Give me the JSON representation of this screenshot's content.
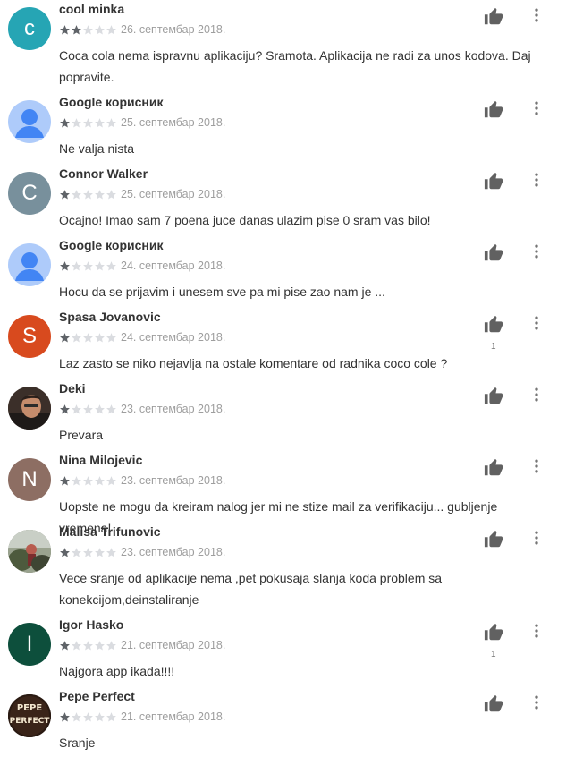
{
  "reviews": [
    {
      "author": "cool minka",
      "avatar_letter": "c",
      "avatar_color": "#26a5b4",
      "avatar_type": "letter",
      "stars": 2,
      "date": "26. септембар 2018.",
      "text": "Coca cola nema ispravnu aplikaciju? Sramota. Aplikacija ne radi za unos kodova. Daj popravite.",
      "likes": ""
    },
    {
      "author": "Google корисник",
      "avatar_letter": "",
      "avatar_color": "#aecbfa",
      "avatar_type": "person",
      "stars": 1,
      "date": "25. септембар 2018.",
      "text": "Ne valja nista",
      "likes": ""
    },
    {
      "author": "Connor Walker",
      "avatar_letter": "C",
      "avatar_color": "#78909c",
      "avatar_type": "letter",
      "stars": 1,
      "date": "25. септембар 2018.",
      "text": "Ocajno! Imao sam 7 poena juce danas ulazim pise 0 sram vas bilo!",
      "likes": ""
    },
    {
      "author": "Google корисник",
      "avatar_letter": "",
      "avatar_color": "#aecbfa",
      "avatar_type": "person",
      "stars": 1,
      "date": "24. септембар 2018.",
      "text": "Hocu da se prijavim i unesem sve pa mi pise zao nam je ...",
      "likes": ""
    },
    {
      "author": "Spasa Jovanovic",
      "avatar_letter": "S",
      "avatar_color": "#d84a1e",
      "avatar_type": "letter",
      "stars": 1,
      "date": "24. септембар 2018.",
      "text": "Laz zasto se niko nejavlja na ostale komentare od radnika coco cole ?",
      "likes": "1"
    },
    {
      "author": "Deki",
      "avatar_letter": "",
      "avatar_color": "#5d4a3e",
      "avatar_type": "photo-man",
      "stars": 1,
      "date": "23. септембар 2018.",
      "text": "Prevara",
      "likes": ""
    },
    {
      "author": "Nina Milojevic",
      "avatar_letter": "N",
      "avatar_color": "#8d6e63",
      "avatar_type": "letter",
      "stars": 1,
      "date": "23. септембар 2018.",
      "text": "Uopste ne mogu da kreiram nalog jer mi ne stize mail za verifikaciju... gubljenje vremena!",
      "likes": ""
    },
    {
      "author": "Malisa Trifunovic",
      "avatar_letter": "",
      "avatar_color": "#6b6f5e",
      "avatar_type": "photo-outdoor",
      "stars": 1,
      "date": "23. септембар 2018.",
      "text": "Vece sranje od aplikacije nema ,pet pokusaja slanja koda problem sa konekcijom,deinstaliranje",
      "likes": ""
    },
    {
      "author": "Igor Hasko",
      "avatar_letter": "I",
      "avatar_color": "#0d4f3c",
      "avatar_type": "letter",
      "stars": 1,
      "date": "21. септембар 2018.",
      "text": "Najgora app ikada!!!!",
      "likes": "1"
    },
    {
      "author": "Pepe Perfect",
      "avatar_letter": "",
      "avatar_color": "#2a1a12",
      "avatar_type": "pepe-logo",
      "stars": 1,
      "date": "21. септембар 2018.",
      "text": "Sranje",
      "likes": "",
      "avatar_logo": {
        "line1": "PEPE",
        "line2": "PERFECT"
      }
    }
  ],
  "colors": {
    "star_filled": "#5f6368",
    "star_empty": "#dadce0",
    "icon": "#757575",
    "like_icon": "#616161"
  },
  "icons": {
    "like": "thumb-up-icon",
    "more": "more-vert-icon"
  }
}
